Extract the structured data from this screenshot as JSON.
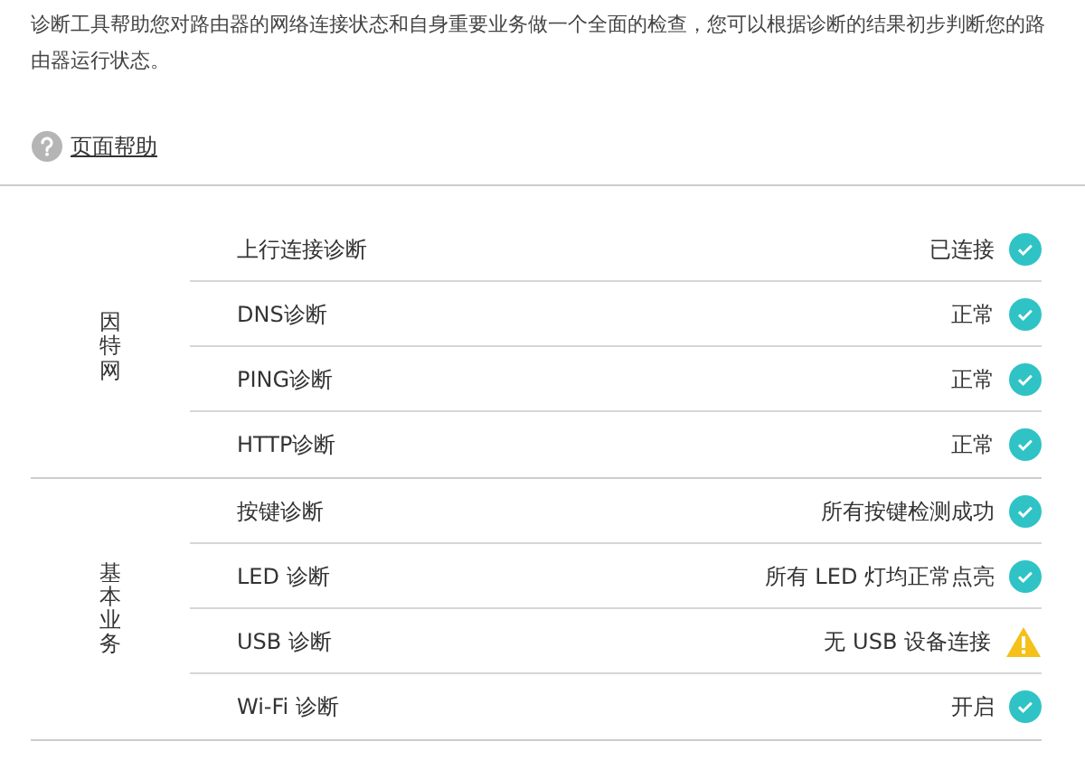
{
  "intro": "诊断工具帮助您对路由器的网络连接状态和自身重要业务做一个全面的检查，您可以根据诊断的结果初步判断您的路由器运行状态。",
  "help_link": "页面帮助",
  "groups": [
    {
      "label": "因特网",
      "items": [
        {
          "name": "上行连接诊断",
          "result": "已连接",
          "kind": "ok"
        },
        {
          "name": "DNS诊断",
          "result": "正常",
          "kind": "ok"
        },
        {
          "name": "PING诊断",
          "result": "正常",
          "kind": "ok"
        },
        {
          "name": "HTTP诊断",
          "result": "正常",
          "kind": "ok"
        }
      ]
    },
    {
      "label": "基本业务",
      "items": [
        {
          "name": "按键诊断",
          "result": "所有按键检测成功",
          "kind": "ok"
        },
        {
          "name": "LED 诊断",
          "result": "所有 LED 灯均正常点亮",
          "kind": "ok"
        },
        {
          "name": "USB 诊断",
          "result": "无 USB 设备连接",
          "kind": "warning"
        },
        {
          "name": "Wi-Fi 诊断",
          "result": "开启",
          "kind": "ok"
        }
      ]
    }
  ]
}
